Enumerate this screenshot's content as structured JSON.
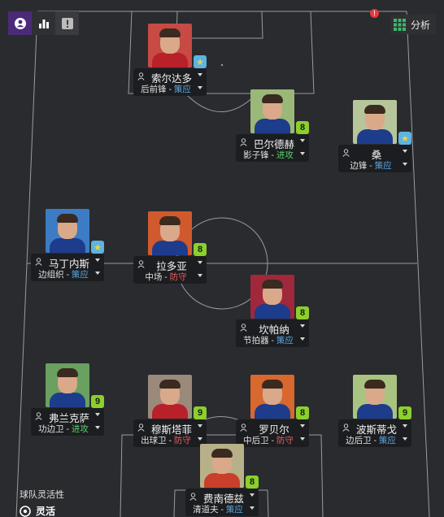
{
  "toolbar": {
    "buttons": [
      {
        "icon": "player-profile-icon",
        "active": true
      },
      {
        "icon": "bar-chart-icon",
        "active": false
      },
      {
        "icon": "warning-icon",
        "active": false
      }
    ]
  },
  "alert": {
    "label": "!"
  },
  "analysis": {
    "label": "分析",
    "icon": "grid-icon"
  },
  "players": [
    {
      "name": "索尔达多",
      "role": "后前锋",
      "duty": "策应",
      "duty_type": "support",
      "badge": "★",
      "badge_type": "star",
      "kit": "#b8202a",
      "bg": "#c74a44"
    },
    {
      "name": "巴尔德赫",
      "role": "影子锋",
      "duty": "进攻",
      "duty_type": "attack",
      "badge": "8",
      "badge_type": "num",
      "kit": "#1e3c8c",
      "bg": "#9ab877"
    },
    {
      "name": "桑",
      "role": "边锋",
      "duty": "策应",
      "duty_type": "support",
      "badge": "★",
      "badge_type": "star",
      "kit": "#1e3c8c",
      "bg": "#b6c69a"
    },
    {
      "name": "马丁内斯",
      "role": "边组织",
      "duty": "策应",
      "duty_type": "support",
      "badge": "★",
      "badge_type": "star",
      "kit": "#1e3c8c",
      "bg": "#3c7cc4"
    },
    {
      "name": "拉多亚",
      "role": "中场",
      "duty": "防守",
      "duty_type": "defend",
      "badge": "8",
      "badge_type": "num",
      "kit": "#1e3c8c",
      "bg": "#d05a2e"
    },
    {
      "name": "坎帕纳",
      "role": "节拍器",
      "duty": "策应",
      "duty_type": "support",
      "badge": "8",
      "badge_type": "num",
      "kit": "#1e3c8c",
      "bg": "#a0283a"
    },
    {
      "name": "弗兰克萨",
      "role": "功边卫",
      "duty": "进攻",
      "duty_type": "attack",
      "badge": "9",
      "badge_type": "num",
      "kit": "#1e3c8c",
      "bg": "#6aa060"
    },
    {
      "name": "穆斯塔菲",
      "role": "出球卫",
      "duty": "防守",
      "duty_type": "defend",
      "badge": "9",
      "badge_type": "num",
      "kit": "#b8202a",
      "bg": "#9a8a7c"
    },
    {
      "name": "罗贝尔",
      "role": "中后卫",
      "duty": "防守",
      "duty_type": "defend",
      "badge": "8",
      "badge_type": "num",
      "kit": "#1e3c8c",
      "bg": "#d8682e"
    },
    {
      "name": "波斯蒂戈",
      "role": "边后卫",
      "duty": "策应",
      "duty_type": "support",
      "badge": "9",
      "badge_type": "num",
      "kit": "#1e3c8c",
      "bg": "#a8c480"
    },
    {
      "name": "费南德兹",
      "role": "清道夫",
      "duty": "策应",
      "duty_type": "support",
      "badge": "8",
      "badge_type": "num",
      "kit": "#c8402a",
      "bg": "#b8b088"
    }
  ],
  "team_flexibility": {
    "title": "球队灵活性",
    "value": "灵活"
  },
  "colors": {
    "support": "#5aa9e6",
    "attack": "#58d36b",
    "defend": "#ef5b5b",
    "toolbar_active": "#4b2a78"
  }
}
